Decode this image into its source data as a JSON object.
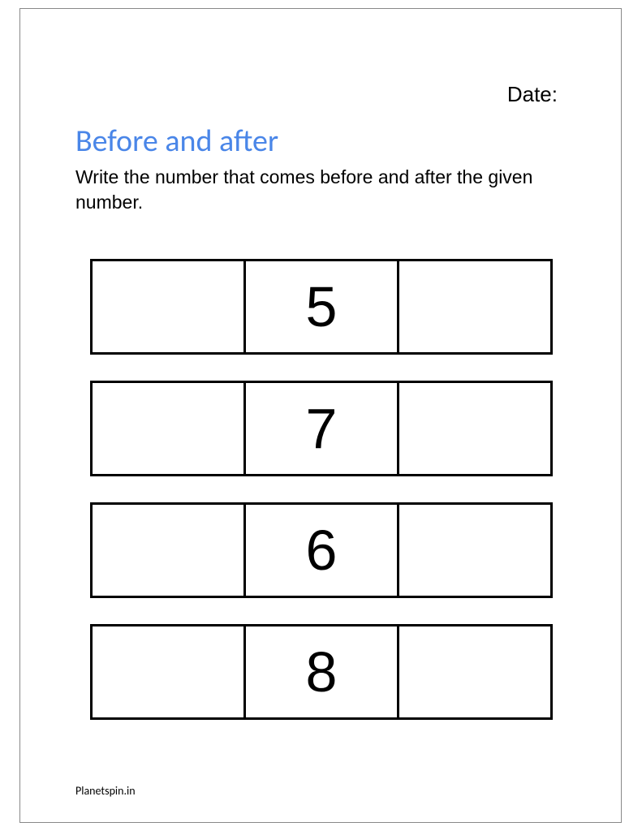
{
  "header": {
    "date_label": "Date:"
  },
  "title": "Before and after",
  "instructions": "Write the number that comes before and after the given number.",
  "rows": [
    {
      "before": "",
      "given": "5",
      "after": ""
    },
    {
      "before": "",
      "given": "7",
      "after": ""
    },
    {
      "before": "",
      "given": "6",
      "after": ""
    },
    {
      "before": "",
      "given": "8",
      "after": ""
    }
  ],
  "footer": "Planetspin.in"
}
